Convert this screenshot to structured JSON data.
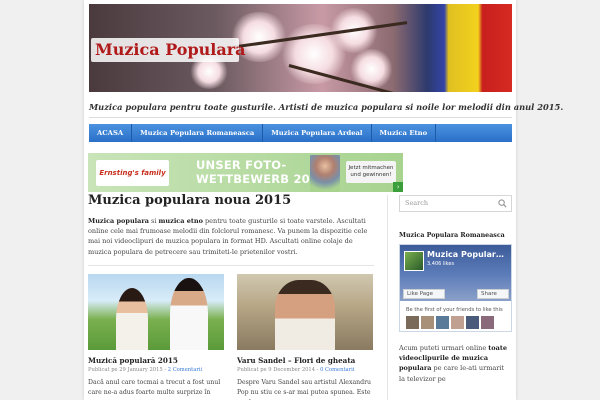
{
  "site": {
    "title": "Muzica Populara",
    "tagline": "Muzica populara pentru toate gusturile. Artisti de muzica populara si noile lor melodii din anul 2015."
  },
  "nav": {
    "items": [
      "ACASA",
      "Muzica Populara Romaneasca",
      "Muzica Populara Ardeal",
      "Muzica Etno"
    ]
  },
  "ad": {
    "logo": "Ernsting's family",
    "headline_line1": "UNSER FOTO-",
    "headline_line2": "WETTBEWERB 2016",
    "cta_line1": "Jetzt mitmachen",
    "cta_line2": "und gewinnen!",
    "arrow": "›"
  },
  "main": {
    "title": "Muzica populara noua 2015",
    "intro_bold1": "Muzica populara",
    "intro_mid1": " si ",
    "intro_bold2": "muzica etno",
    "intro_rest": " pentru toate gusturile si toate varstele. Ascultati online cele mai frumoase melodii din folclorul romanesc. Va punem la dispozitie cele mai noi videoclipuri de muzica populara in format HD. Ascultati online colaje de muzica populara de petrecere sau trimiteti-le prietenilor vostri."
  },
  "posts": [
    {
      "title": "Muzică populară 2015",
      "meta_prefix": "Publicat pe 29 January 2015 - ",
      "comments": "2 Comentarii",
      "excerpt": "Dacă anul care tocmai a trecut a fost unul care ne-a adus foarte multe surprize în ce…"
    },
    {
      "title": "Varu Sandel – Flori de gheata",
      "meta_prefix": "Publicat pe 9 December 2014 - ",
      "comments": "0 Comentarii",
      "excerpt": "Despre Varu Sandel sau artistul Alexandru Pop nu stiu ce s-ar mai putea spunea. Este unul"
    }
  ],
  "sidebar": {
    "search_placeholder": "Search",
    "widget_title": "Muzica Populara Romaneasca",
    "fb_page_name": "Muzica Popular…",
    "fb_likes": "3,406 likes",
    "fb_like_label": "Like Page",
    "fb_share_label": "Share",
    "fb_friends_text": "Be the first of your friends to like this",
    "text_prefix": "Acum puteti urmari online ",
    "text_bold": "toate videoclipurile de muzica populara",
    "text_suffix": " pe care le-ati urmarit la televizor pe"
  },
  "colors": {
    "nav_bg": "#2a70c8",
    "title_red": "#b01a1a",
    "link_blue": "#3a7bd5",
    "fb_blue": "#3b5b99"
  },
  "icons": {
    "search": "search-icon",
    "ad_next": "chevron-right-icon"
  }
}
